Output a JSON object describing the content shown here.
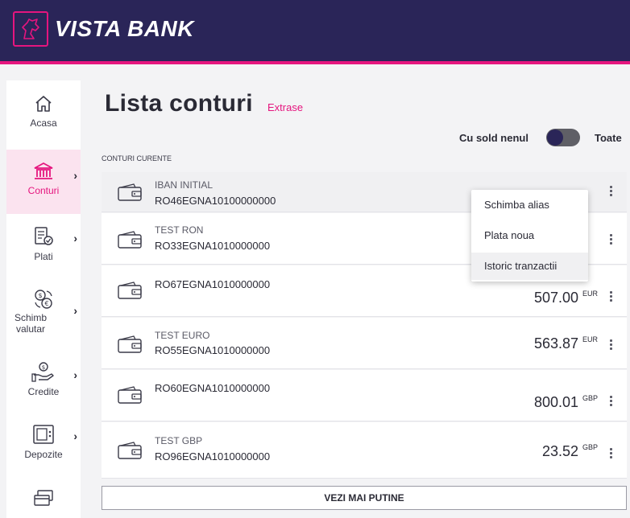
{
  "app": {
    "brand": "VISTA BANK"
  },
  "sidebar": {
    "items": [
      {
        "label": "Acasa",
        "icon": "home-icon",
        "active": false
      },
      {
        "label": "Conturi",
        "icon": "bank-icon",
        "active": true
      },
      {
        "label": "Plati",
        "icon": "payments-icon",
        "active": false
      },
      {
        "label": "Schimb valutar",
        "icon": "currency-exchange-icon",
        "active": false
      },
      {
        "label": "Credite",
        "icon": "credit-icon",
        "active": false
      },
      {
        "label": "Depozite",
        "icon": "deposit-icon",
        "active": false
      },
      {
        "label": "",
        "icon": "cards-icon",
        "active": false
      }
    ]
  },
  "page": {
    "title": "Lista conturi",
    "link": "Extrase",
    "toggle_label": "Cu sold nenul",
    "toggle_all": "Toate",
    "section_label": "CONTURI CURENTE"
  },
  "accounts": [
    {
      "alias": "IBAN INITIAL",
      "iban": "RO46EGNA10100000000",
      "amount": "",
      "currency": ""
    },
    {
      "alias": "TEST RON",
      "iban": "RO33EGNA1010000000",
      "amount": "",
      "currency": ""
    },
    {
      "alias": "",
      "iban": "RO67EGNA1010000000",
      "amount": "507.00",
      "currency": "EUR"
    },
    {
      "alias": "TEST EURO",
      "iban": "RO55EGNA1010000000",
      "amount": "563.87",
      "currency": "EUR"
    },
    {
      "alias": "",
      "iban": "RO60EGNA1010000000",
      "amount": "800.01",
      "currency": "GBP"
    },
    {
      "alias": "TEST GBP",
      "iban": "RO96EGNA1010000000",
      "amount": "23.52",
      "currency": "GBP"
    }
  ],
  "more_button": "VEZI MAI PUTINE",
  "context_menu": {
    "items": [
      "Schimba alias",
      "Plata noua",
      "Istoric tranzactii"
    ],
    "highlighted": "Istoric tranzactii"
  },
  "colors": {
    "brand": "#2a2558",
    "accent": "#e5157e"
  }
}
